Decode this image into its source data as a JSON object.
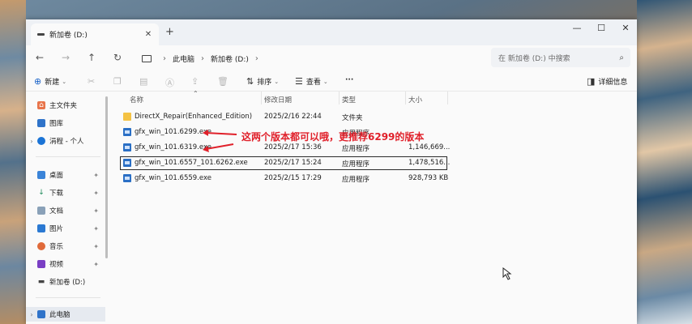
{
  "tab": {
    "title": "新加卷 (D:)",
    "close": "✕",
    "new": "+"
  },
  "window_controls": {
    "minimize": "—",
    "maximize": "☐",
    "close": "✕"
  },
  "nav": {
    "back": "←",
    "forward": "→",
    "up": "↑",
    "refresh": "↻"
  },
  "breadcrumb": [
    "此电脑",
    "新加卷 (D:)"
  ],
  "search": {
    "placeholder": "在 新加卷 (D:) 中搜索"
  },
  "commands": {
    "new": "新建",
    "sort": "排序",
    "view": "查看",
    "more": "···",
    "details": "详细信息"
  },
  "sidebar": {
    "items": [
      {
        "label": "主文件夹",
        "icon": "home-icon"
      },
      {
        "label": "图库",
        "icon": "gallery-icon"
      },
      {
        "label": "涓程 - 个人",
        "icon": "cloud-icon"
      },
      {
        "label": "桌面",
        "icon": "desktop-icon",
        "pinned": true
      },
      {
        "label": "下载",
        "icon": "download-icon",
        "pinned": true
      },
      {
        "label": "文档",
        "icon": "documents-icon",
        "pinned": true
      },
      {
        "label": "图片",
        "icon": "pictures-icon",
        "pinned": true
      },
      {
        "label": "音乐",
        "icon": "music-icon",
        "pinned": true
      },
      {
        "label": "视频",
        "icon": "videos-icon",
        "pinned": true
      },
      {
        "label": "新加卷 (D:)",
        "icon": "drive-icon"
      },
      {
        "label": "此电脑",
        "icon": "this-pc-icon"
      }
    ]
  },
  "columns": {
    "name": "名称",
    "modified": "修改日期",
    "type": "类型",
    "size": "大小"
  },
  "files": [
    {
      "name": "DirectX_Repair(Enhanced_Edition)",
      "modified": "2025/2/16 22:44",
      "type": "文件夹",
      "size": "",
      "kind": "folder"
    },
    {
      "name": "gfx_win_101.6299.exe",
      "modified": "",
      "type": "应用程序",
      "size": "",
      "kind": "exe"
    },
    {
      "name": "gfx_win_101.6319.exe",
      "modified": "2025/2/17 15:36",
      "type": "应用程序",
      "size": "1,146,669...",
      "kind": "exe"
    },
    {
      "name": "gfx_win_101.6557_101.6262.exe",
      "modified": "2025/2/17 15:24",
      "type": "应用程序",
      "size": "1,478,516...",
      "kind": "exe"
    },
    {
      "name": "gfx_win_101.6559.exe",
      "modified": "2025/2/15 17:29",
      "type": "应用程序",
      "size": "928,793 KB",
      "kind": "exe"
    }
  ],
  "annotation": "这两个版本都可以哦，更推荐6299的版本",
  "colors": {
    "annotation": "#e0202a",
    "accent": "#1c64c8",
    "folder": "#f4c243"
  }
}
